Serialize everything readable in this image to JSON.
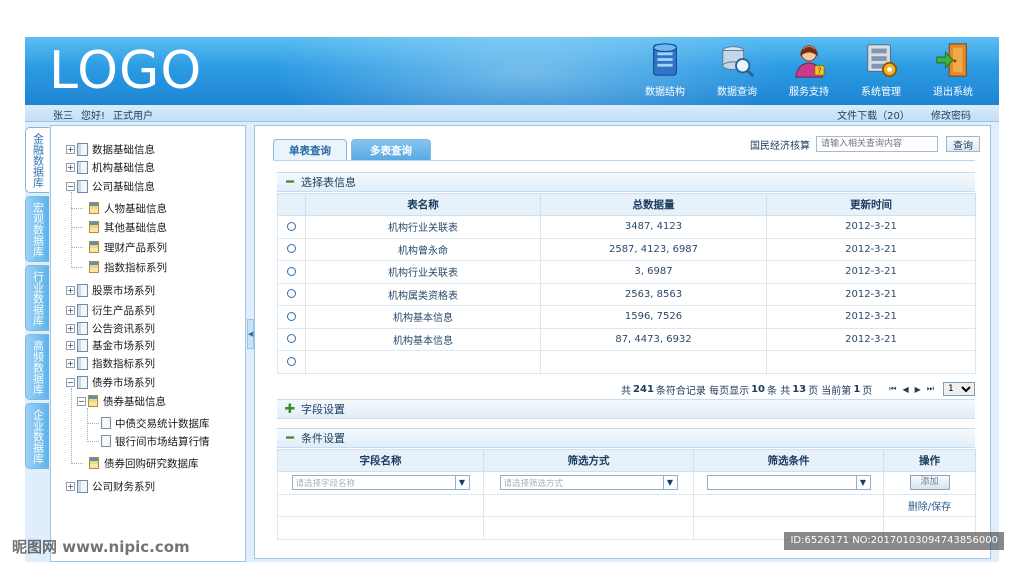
{
  "header": {
    "logo": "LOGO",
    "nav": [
      {
        "label": "数据结构",
        "icon": "database-server-icon"
      },
      {
        "label": "数据查询",
        "icon": "data-search-icon"
      },
      {
        "label": "服务支持",
        "icon": "support-user-icon"
      },
      {
        "label": "系统管理",
        "icon": "system-settings-icon"
      },
      {
        "label": "退出系统",
        "icon": "exit-door-icon"
      }
    ]
  },
  "subbar": {
    "user_name": "张三",
    "greeting": "您好!",
    "role": "正式用户",
    "downloads": "文件下载（20）",
    "change_password": "修改密码"
  },
  "side_tabs": [
    "金融数据库",
    "宏观数据库",
    "行业数据库",
    "高频数据库",
    "企业数据库"
  ],
  "tree": {
    "nodes": [
      "数据基础信息",
      "机构基础信息",
      "公司基础信息",
      "人物基础信息",
      "其他基础信息",
      "理财产品系列",
      "指数指标系列",
      "股票市场系列",
      "衍生产品系列",
      "公告资讯系列",
      "基金市场系列",
      "指数指标系列",
      "债券市场系列",
      "债券基础信息",
      "中债交易统计数据库",
      "银行间市场结算行情",
      "债券回购研究数据库",
      "公司财务系列"
    ]
  },
  "main": {
    "tabs": [
      "单表查询",
      "多表查询"
    ],
    "search": {
      "label": "国民经济核算",
      "placeholder": "请输入相关查询内容",
      "button": "查询"
    },
    "section_table": {
      "title": "选择表信息",
      "columns": [
        "表名称",
        "总数据量",
        "更新时间"
      ],
      "rows": [
        {
          "name": "机构行业关联表",
          "count": "3487, 4123",
          "date": "2012-3-21"
        },
        {
          "name": "机构曾永命",
          "count": "2587, 4123, 6987",
          "date": "2012-3-21"
        },
        {
          "name": "机构行业关联表",
          "count": "3, 6987",
          "date": "2012-3-21"
        },
        {
          "name": "机构属类资格表",
          "count": "2563, 8563",
          "date": "2012-3-21"
        },
        {
          "name": "机构基本信息",
          "count": "1596, 7526",
          "date": "2012-3-21"
        },
        {
          "name": "机构基本信息",
          "count": "87, 4473, 6932",
          "date": "2012-3-21"
        },
        {
          "name": "",
          "count": "",
          "date": ""
        }
      ]
    },
    "pager": {
      "t1": "共",
      "total": "241",
      "t2": "条符合记录 每页显示",
      "per_page": "10",
      "t3": "条 共",
      "pages": "13",
      "t4": "页 当前第",
      "current": "1",
      "t5": "页",
      "first": "⏮",
      "prev": "◀",
      "next": "▶",
      "last": "⏭",
      "select_value": "1"
    },
    "section_fields": {
      "title": "字段设置"
    },
    "section_conditions": {
      "title": "条件设置",
      "columns": [
        "字段名称",
        "筛选方式",
        "筛选条件",
        "操作"
      ],
      "field_placeholder": "请选择字段名称",
      "method_placeholder": "请选择筛选方式",
      "condition_placeholder": "",
      "add_button": "添加",
      "delete_save": "删除/保存"
    }
  },
  "watermark": {
    "left": "昵图网 www.nipic.com",
    "right": "ID:6526171 NO:20170103094743856000"
  },
  "colors": {
    "header_blue": "#2b9be3",
    "panel_bg": "#dfeefa",
    "border": "#9cc6e8"
  }
}
